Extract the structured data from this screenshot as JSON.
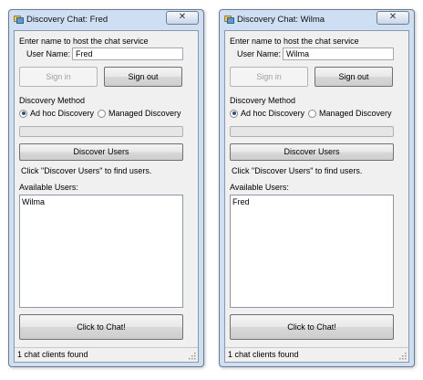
{
  "windows": [
    {
      "title": "Discovery Chat: Fred",
      "close_glyph": "✕",
      "host_label": "Enter name to host the chat service",
      "username_label": "User Name:",
      "username_value": "Fred",
      "signin_label": "Sign in",
      "signout_label": "Sign out",
      "discovery_label": "Discovery Method",
      "adhoc_label": "Ad hoc Discovery",
      "managed_label": "Managed Discovery",
      "discover_button": "Discover Users",
      "hint": "Click \"Discover Users\" to find users.",
      "available_label": "Available Users:",
      "users": [
        "Wilma"
      ],
      "chat_button": "Click to Chat!",
      "status": "1 chat clients found"
    },
    {
      "title": "Discovery Chat: Wilma",
      "close_glyph": "✕",
      "host_label": "Enter name to host the chat service",
      "username_label": "User Name:",
      "username_value": "Wilma",
      "signin_label": "Sign in",
      "signout_label": "Sign out",
      "discovery_label": "Discovery Method",
      "adhoc_label": "Ad hoc Discovery",
      "managed_label": "Managed Discovery",
      "discover_button": "Discover Users",
      "hint": "Click \"Discover Users\" to find users.",
      "available_label": "Available Users:",
      "users": [
        "Fred"
      ],
      "chat_button": "Click to Chat!",
      "status": "1 chat clients found"
    }
  ],
  "state": {
    "signin_enabled": false,
    "adhoc_selected": true,
    "managed_selected": false,
    "discovery_progress": 0
  },
  "icons": {
    "app": "app-window-icon",
    "close": "close-icon",
    "grip": "resize-grip-icon"
  }
}
